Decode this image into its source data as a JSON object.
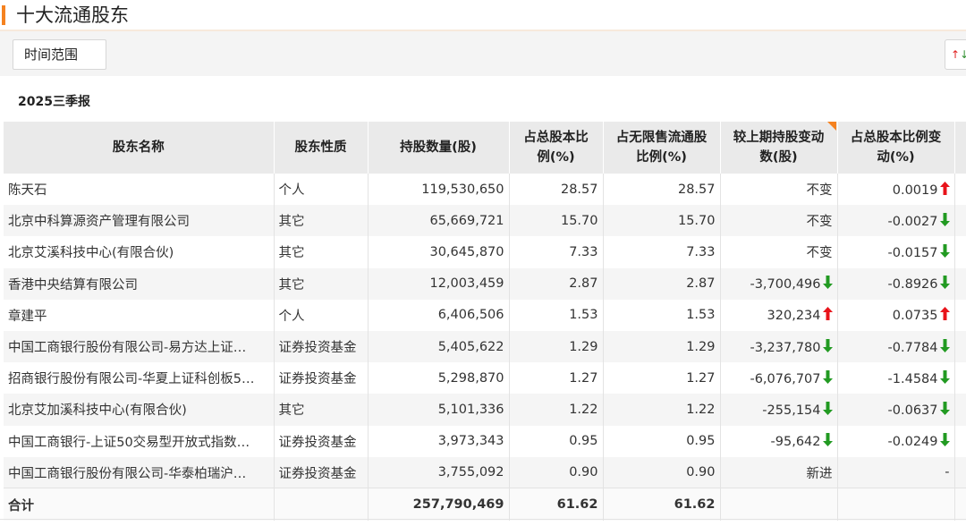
{
  "header": {
    "title": "十大流通股东"
  },
  "filter": {
    "range_label": "时间范围",
    "sort_icon_up": "↑",
    "sort_icon_down": "↓"
  },
  "period": "2025三季报",
  "table": {
    "columns": [
      "股东名称",
      "股东性质",
      "持股数量(股)",
      "占总股本比例(%)",
      "占无限售流通股比例(%)",
      "较上期持股变动数(股)",
      "占总股本比例变动(%)"
    ],
    "column_header_lines": [
      [
        "股东名称"
      ],
      [
        "股东性质"
      ],
      [
        "持股数量(股)"
      ],
      [
        "占总股本比",
        "例(%)"
      ],
      [
        "占无限售流通股",
        "比例(%)"
      ],
      [
        "较上期持股变动",
        "数(股)"
      ],
      [
        "占总股本比例变",
        "动(%)"
      ]
    ],
    "rows": [
      {
        "name": "陈天石",
        "type": "个人",
        "shares": "119,530,650",
        "pct_total": "28.57",
        "pct_float": "28.57",
        "change": "不变",
        "change_dir": "none",
        "pct_change": "0.0019",
        "pct_change_dir": "up"
      },
      {
        "name": "北京中科算源资产管理有限公司",
        "type": "其它",
        "shares": "65,669,721",
        "pct_total": "15.70",
        "pct_float": "15.70",
        "change": "不变",
        "change_dir": "none",
        "pct_change": "-0.0027",
        "pct_change_dir": "down"
      },
      {
        "name": "北京艾溪科技中心(有限合伙)",
        "type": "其它",
        "shares": "30,645,870",
        "pct_total": "7.33",
        "pct_float": "7.33",
        "change": "不变",
        "change_dir": "none",
        "pct_change": "-0.0157",
        "pct_change_dir": "down"
      },
      {
        "name": "香港中央结算有限公司",
        "type": "其它",
        "shares": "12,003,459",
        "pct_total": "2.87",
        "pct_float": "2.87",
        "change": "-3,700,496",
        "change_dir": "down",
        "pct_change": "-0.8926",
        "pct_change_dir": "down"
      },
      {
        "name": "章建平",
        "type": "个人",
        "shares": "6,406,506",
        "pct_total": "1.53",
        "pct_float": "1.53",
        "change": "320,234",
        "change_dir": "up",
        "pct_change": "0.0735",
        "pct_change_dir": "up"
      },
      {
        "name": "中国工商银行股份有限公司-易方达上证…",
        "type": "证券投资基金",
        "shares": "5,405,622",
        "pct_total": "1.29",
        "pct_float": "1.29",
        "change": "-3,237,780",
        "change_dir": "down",
        "pct_change": "-0.7784",
        "pct_change_dir": "down"
      },
      {
        "name": "招商银行股份有限公司-华夏上证科创板5…",
        "type": "证券投资基金",
        "shares": "5,298,870",
        "pct_total": "1.27",
        "pct_float": "1.27",
        "change": "-6,076,707",
        "change_dir": "down",
        "pct_change": "-1.4584",
        "pct_change_dir": "down"
      },
      {
        "name": "北京艾加溪科技中心(有限合伙)",
        "type": "其它",
        "shares": "5,101,336",
        "pct_total": "1.22",
        "pct_float": "1.22",
        "change": "-255,154",
        "change_dir": "down",
        "pct_change": "-0.0637",
        "pct_change_dir": "down"
      },
      {
        "name": "中国工商银行-上证50交易型开放式指数…",
        "type": "证券投资基金",
        "shares": "3,973,343",
        "pct_total": "0.95",
        "pct_float": "0.95",
        "change": "-95,642",
        "change_dir": "down",
        "pct_change": "-0.0249",
        "pct_change_dir": "down"
      },
      {
        "name": "中国工商银行股份有限公司-华泰柏瑞沪…",
        "type": "证券投资基金",
        "shares": "3,755,092",
        "pct_total": "0.90",
        "pct_float": "0.90",
        "change": "新进",
        "change_dir": "none",
        "pct_change": "-",
        "pct_change_dir": "none"
      }
    ],
    "total": {
      "label": "合计",
      "shares": "257,790,469",
      "pct_total": "61.62",
      "pct_float": "61.62"
    }
  },
  "colors": {
    "accent": "#f58220",
    "up": "#e8131a",
    "down": "#229a22",
    "header_bg": "#eaeaea"
  }
}
